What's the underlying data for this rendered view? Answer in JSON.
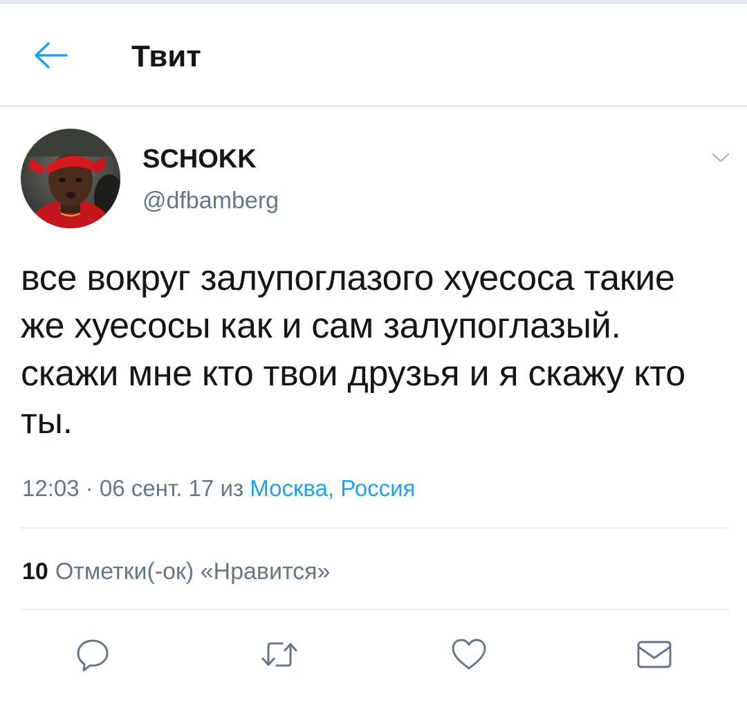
{
  "header": {
    "back_icon": "arrow-left-icon",
    "title": "Твит"
  },
  "tweet": {
    "author": {
      "name": "SCHOKK",
      "handle": "@dfbamberg",
      "avatar_icon": "user-avatar"
    },
    "caret_icon": "chevron-down-icon",
    "text": "все вокруг залупоглазого хуесоса такие же хуесосы как и сам залупоглазый. скажи мне кто твои друзья и я скажу кто ты.",
    "meta": {
      "timestamp": "12:03 · 06 сент. 17 из",
      "location": "Москва, Россия"
    },
    "likes": {
      "count": "10",
      "label": "Отметки(-ок) «Нравится»"
    },
    "actions": [
      {
        "name": "reply",
        "icon": "reply-icon"
      },
      {
        "name": "retweet",
        "icon": "retweet-icon"
      },
      {
        "name": "like",
        "icon": "heart-icon"
      },
      {
        "name": "direct-message",
        "icon": "envelope-icon"
      }
    ]
  },
  "colors": {
    "accent": "#1da1f2",
    "text": "#14171a",
    "secondary": "#657786",
    "divider": "#e6ecf0"
  }
}
